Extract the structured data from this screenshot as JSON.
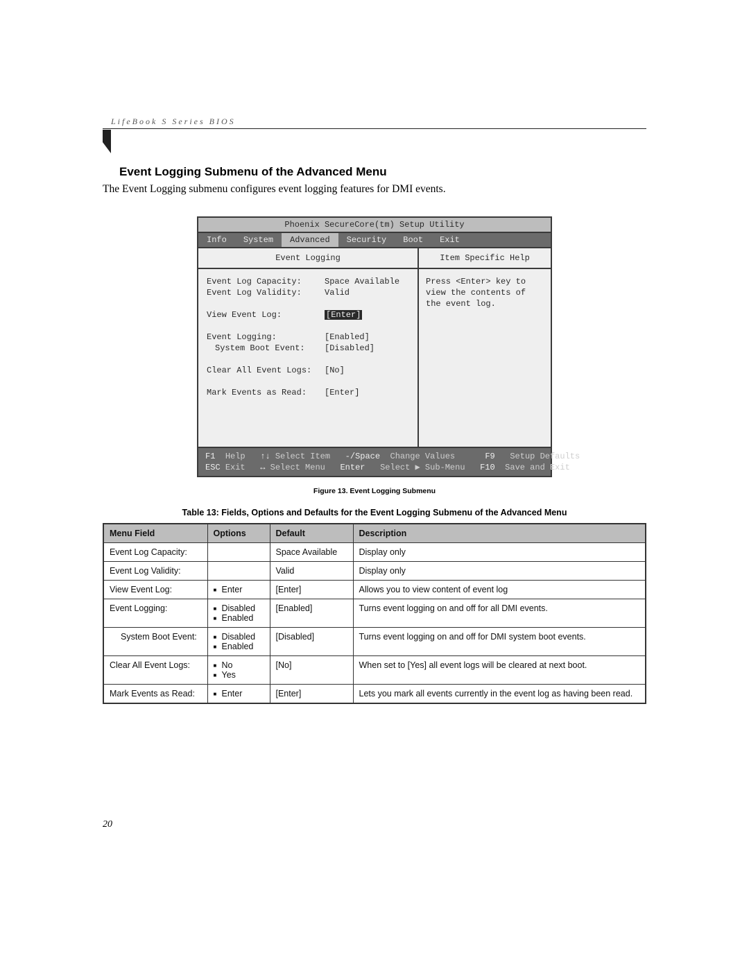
{
  "running_head": "LifeBook S Series BIOS",
  "heading": "Event Logging Submenu of the Advanced Menu",
  "intro": "The Event Logging submenu configures event logging features for DMI events.",
  "bios": {
    "title": "Phoenix SecureCore(tm) Setup Utility",
    "tabs": [
      "Info",
      "System",
      "Advanced",
      "Security",
      "Boot",
      "Exit"
    ],
    "active_tab": "Advanced",
    "left_head": "Event Logging",
    "right_head": "Item Specific Help",
    "help_text": "Press <Enter> key to view the contents of the event log.",
    "items": [
      {
        "label": "Event Log Capacity:",
        "value": "Space Available",
        "indent": false,
        "gap_after": false
      },
      {
        "label": "Event Log Validity:",
        "value": "Valid",
        "indent": false,
        "gap_after": true
      },
      {
        "label": "View Event Log:",
        "value": "[Enter]",
        "indent": false,
        "gap_after": true,
        "selected": true
      },
      {
        "label": "Event Logging:",
        "value": "[Enabled]",
        "indent": false,
        "gap_after": false
      },
      {
        "label": "System Boot Event:",
        "value": "[Disabled]",
        "indent": true,
        "gap_after": true
      },
      {
        "label": "Clear All Event Logs:",
        "value": "[No]",
        "indent": false,
        "gap_after": true
      },
      {
        "label": "Mark Events as Read:",
        "value": "[Enter]",
        "indent": false,
        "gap_after": false
      }
    ],
    "footer": {
      "r1": {
        "c1k": "F1",
        "c1d": "Help",
        "c2k": "↑↓",
        "c2d": "Select Item",
        "c3k": "-/Space",
        "c3d": "Change Values",
        "c4k": "F9",
        "c4d": "Setup Defaults"
      },
      "r2": {
        "c1k": "ESC",
        "c1d": "Exit",
        "c2k": "↔",
        "c2d": "Select Menu",
        "c3k": "Enter",
        "c3d": "Select ▶ Sub-Menu",
        "c4k": "F10",
        "c4d": "Save and Exit"
      }
    }
  },
  "figure_caption": "Figure 13.  Event Logging Submenu",
  "table_caption": "Table 13: Fields, Options and Defaults for the Event Logging Submenu of the Advanced Menu",
  "headers": {
    "menu": "Menu Field",
    "options": "Options",
    "def": "Default",
    "desc": "Description"
  },
  "rows": [
    {
      "menu": "Event Log Capacity:",
      "indent": false,
      "options": [],
      "def": "Space Available",
      "desc": "Display only"
    },
    {
      "menu": "Event Log Validity:",
      "indent": false,
      "options": [],
      "def": "Valid",
      "desc": "Display only"
    },
    {
      "menu": "View Event Log:",
      "indent": false,
      "options": [
        "Enter"
      ],
      "def": "[Enter]",
      "desc": "Allows you to view content of event log"
    },
    {
      "menu": "Event Logging:",
      "indent": false,
      "options": [
        "Disabled",
        "Enabled"
      ],
      "def": "[Enabled]",
      "desc": "Turns event logging on and off for all DMI events."
    },
    {
      "menu": "System Boot Event:",
      "indent": true,
      "options": [
        "Disabled",
        "Enabled"
      ],
      "def": "[Disabled]",
      "desc": "Turns event logging on and off for DMI system boot events."
    },
    {
      "menu": "Clear All Event Logs:",
      "indent": false,
      "options": [
        "No",
        "Yes"
      ],
      "def": "[No]",
      "desc": "When set to [Yes] all event logs will be cleared at next boot."
    },
    {
      "menu": "Mark Events as Read:",
      "indent": false,
      "options": [
        "Enter"
      ],
      "def": "[Enter]",
      "desc": "Lets you mark all events currently in the event log as having been read."
    }
  ],
  "page_number": "20"
}
